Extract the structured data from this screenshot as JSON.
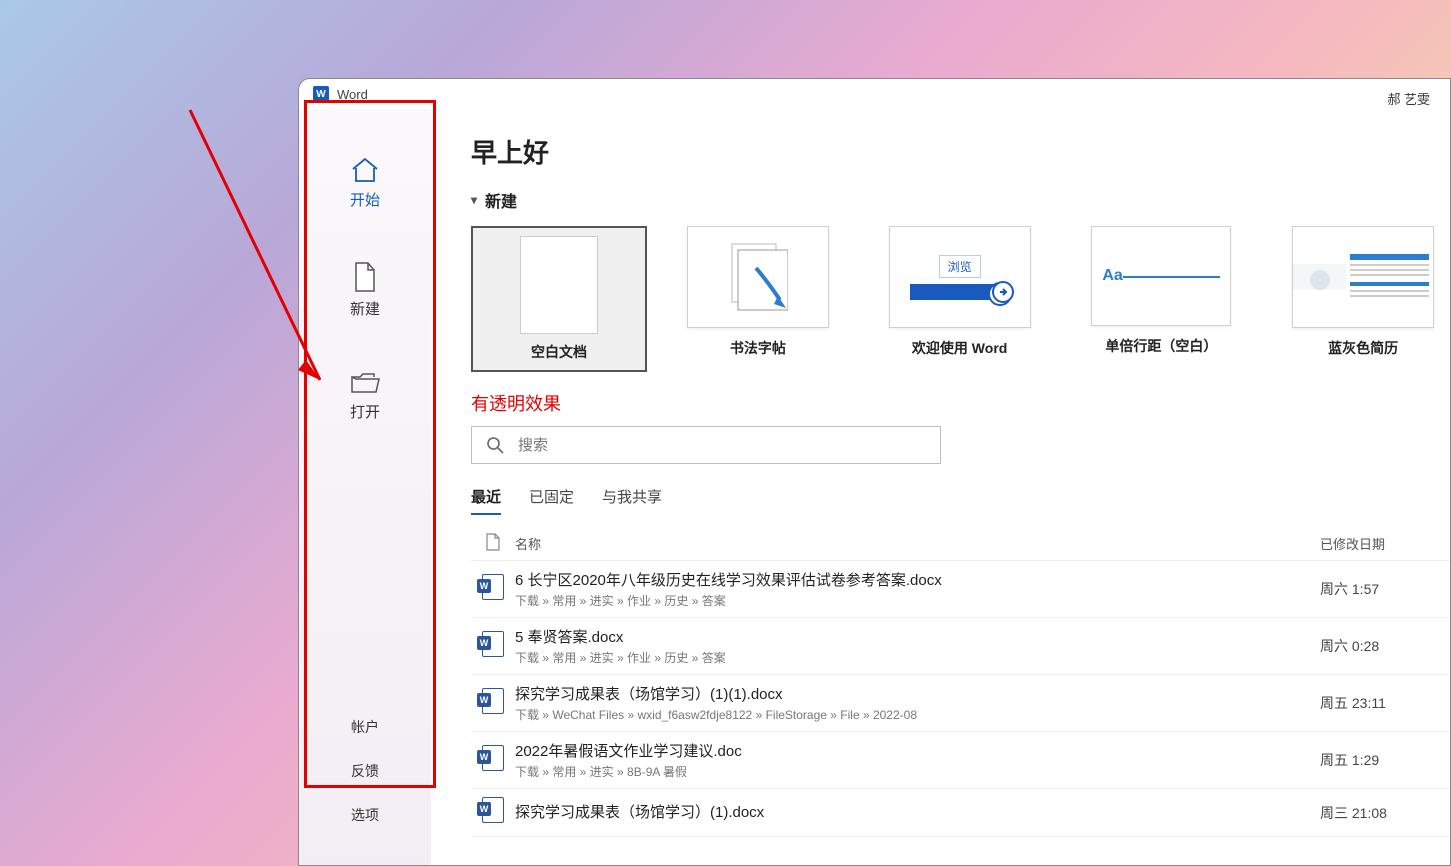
{
  "title": "Word",
  "user": "郝 艺雯",
  "sidebar": {
    "home": "开始",
    "new": "新建",
    "open": "打开",
    "account": "帐户",
    "feedback": "反馈",
    "options": "选项"
  },
  "greeting": "早上好",
  "new_section": "新建",
  "templates": {
    "blank": "空白文档",
    "calligraphy": "书法字帖",
    "welcome": "欢迎使用 Word",
    "welcome_browse": "浏览",
    "single_space": "单倍行距（空白）",
    "single_aa": "Aa",
    "resume": "蓝灰色简历"
  },
  "annotation": "有透明效果",
  "search_placeholder": "搜索",
  "tabs": {
    "recent": "最近",
    "pinned": "已固定",
    "shared": "与我共享"
  },
  "columns": {
    "name": "名称",
    "modified": "已修改日期"
  },
  "files": [
    {
      "name": "6  长宁区2020年八年级历史在线学习效果评估试卷参考答案.docx",
      "path": "下载 » 常用 » 进实 » 作业 » 历史 » 答案",
      "date": "周六 1:57"
    },
    {
      "name": "5  奉贤答案.docx",
      "path": "下载 » 常用 » 进实 » 作业 » 历史 » 答案",
      "date": "周六 0:28"
    },
    {
      "name": "探究学习成果表（场馆学习）(1)(1).docx",
      "path": "下载 » WeChat Files » wxid_f6asw2fdje8122 » FileStorage » File » 2022-08",
      "date": "周五 23:11"
    },
    {
      "name": "2022年暑假语文作业学习建议.doc",
      "path": "下载 » 常用 » 进实 » 8B-9A 暑假",
      "date": "周五 1:29"
    },
    {
      "name": "探究学习成果表（场馆学习）(1).docx",
      "path": "",
      "date": "周三 21:08"
    }
  ]
}
